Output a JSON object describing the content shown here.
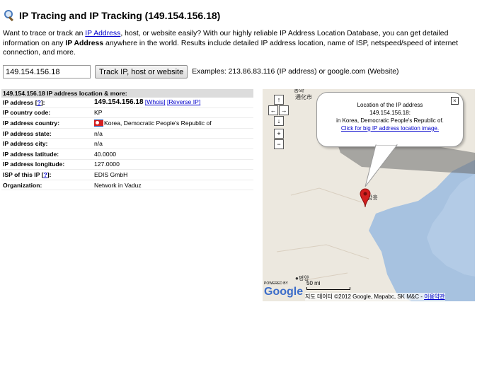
{
  "header": {
    "title": "IP Tracing and IP Tracking (149.154.156.18)"
  },
  "intro": {
    "text1": "Want to trace or track an ",
    "link": "IP Address",
    "text2": ", host, or website easily? With our highly reliable IP Address Location Database, you can get detailed information on any ",
    "bold": "IP Address",
    "text3": " anywhere in the world. Results include detailed IP address location, name of ISP, netspeed/speed of internet connection, and more."
  },
  "search": {
    "value": "149.154.156.18",
    "button": "Track IP, host or website",
    "examples": "Examples: 213.86.83.116 (IP address) or google.com (Website)"
  },
  "table": {
    "header": "149.154.156.18 IP address location & more:",
    "ip_label": "IP address [",
    "ip_help": "?",
    "ip_label_end": "]:",
    "ip_value": "149.154.156.18",
    "whois": "[Whois]",
    "reverse": "[Reverse IP]",
    "rows": [
      {
        "label": "IP country code:",
        "value": "KP"
      },
      {
        "label": "IP address country:",
        "value": "Korea, Democratic People's Republic of"
      },
      {
        "label": "IP address state:",
        "value": "n/a"
      },
      {
        "label": "IP address city:",
        "value": "n/a"
      },
      {
        "label": "IP address latitude:",
        "value": "40.0000"
      },
      {
        "label": "IP address longitude:",
        "value": "127.0000"
      }
    ],
    "isp_label": "ISP of this IP [",
    "isp_help": "?",
    "isp_label_end": "]:",
    "isp_value": "EDIS GmbH",
    "org_label": "Organization:",
    "org_value": "Network in Vaduz"
  },
  "map": {
    "bubble_line1": "Location of the IP address",
    "bubble_line2": "149.154.156.18:",
    "bubble_line3": "in Korea, Democratic People's Republic of.",
    "bubble_link": "Click for big IP address location image.",
    "close": "×",
    "label_tonghua_ko": "통화",
    "label_tonghua_cn": "通化市",
    "label_marker": "함흥",
    "label_pyongyang": "●평양",
    "scale": "50 mi",
    "copyright": "지도 데이터 ©2012 Google, Mapabc, SK M&C - ",
    "terms": "이용약관",
    "powered": "POWERED BY",
    "google": "Google",
    "nav_up": "↑",
    "nav_left": "←",
    "nav_right": "→",
    "nav_down": "↓",
    "zoom_in": "+",
    "zoom_out": "−"
  },
  "colors": {
    "accent": "#0000cc",
    "sea": "#a7c2e0",
    "marker": "#d21f1f"
  }
}
